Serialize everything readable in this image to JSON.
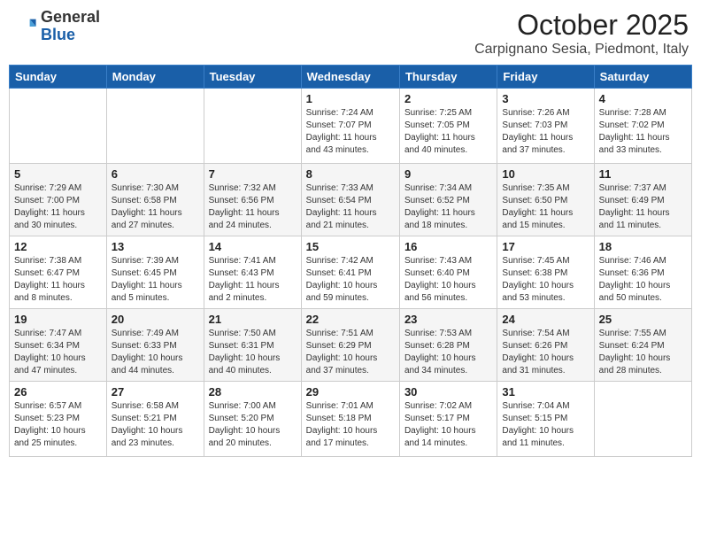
{
  "header": {
    "logo_general": "General",
    "logo_blue": "Blue",
    "month_title": "October 2025",
    "location": "Carpignano Sesia, Piedmont, Italy"
  },
  "weekdays": [
    "Sunday",
    "Monday",
    "Tuesday",
    "Wednesday",
    "Thursday",
    "Friday",
    "Saturday"
  ],
  "weeks": [
    [
      {
        "day": "",
        "info": ""
      },
      {
        "day": "",
        "info": ""
      },
      {
        "day": "",
        "info": ""
      },
      {
        "day": "1",
        "info": "Sunrise: 7:24 AM\nSunset: 7:07 PM\nDaylight: 11 hours\nand 43 minutes."
      },
      {
        "day": "2",
        "info": "Sunrise: 7:25 AM\nSunset: 7:05 PM\nDaylight: 11 hours\nand 40 minutes."
      },
      {
        "day": "3",
        "info": "Sunrise: 7:26 AM\nSunset: 7:03 PM\nDaylight: 11 hours\nand 37 minutes."
      },
      {
        "day": "4",
        "info": "Sunrise: 7:28 AM\nSunset: 7:02 PM\nDaylight: 11 hours\nand 33 minutes."
      }
    ],
    [
      {
        "day": "5",
        "info": "Sunrise: 7:29 AM\nSunset: 7:00 PM\nDaylight: 11 hours\nand 30 minutes."
      },
      {
        "day": "6",
        "info": "Sunrise: 7:30 AM\nSunset: 6:58 PM\nDaylight: 11 hours\nand 27 minutes."
      },
      {
        "day": "7",
        "info": "Sunrise: 7:32 AM\nSunset: 6:56 PM\nDaylight: 11 hours\nand 24 minutes."
      },
      {
        "day": "8",
        "info": "Sunrise: 7:33 AM\nSunset: 6:54 PM\nDaylight: 11 hours\nand 21 minutes."
      },
      {
        "day": "9",
        "info": "Sunrise: 7:34 AM\nSunset: 6:52 PM\nDaylight: 11 hours\nand 18 minutes."
      },
      {
        "day": "10",
        "info": "Sunrise: 7:35 AM\nSunset: 6:50 PM\nDaylight: 11 hours\nand 15 minutes."
      },
      {
        "day": "11",
        "info": "Sunrise: 7:37 AM\nSunset: 6:49 PM\nDaylight: 11 hours\nand 11 minutes."
      }
    ],
    [
      {
        "day": "12",
        "info": "Sunrise: 7:38 AM\nSunset: 6:47 PM\nDaylight: 11 hours\nand 8 minutes."
      },
      {
        "day": "13",
        "info": "Sunrise: 7:39 AM\nSunset: 6:45 PM\nDaylight: 11 hours\nand 5 minutes."
      },
      {
        "day": "14",
        "info": "Sunrise: 7:41 AM\nSunset: 6:43 PM\nDaylight: 11 hours\nand 2 minutes."
      },
      {
        "day": "15",
        "info": "Sunrise: 7:42 AM\nSunset: 6:41 PM\nDaylight: 10 hours\nand 59 minutes."
      },
      {
        "day": "16",
        "info": "Sunrise: 7:43 AM\nSunset: 6:40 PM\nDaylight: 10 hours\nand 56 minutes."
      },
      {
        "day": "17",
        "info": "Sunrise: 7:45 AM\nSunset: 6:38 PM\nDaylight: 10 hours\nand 53 minutes."
      },
      {
        "day": "18",
        "info": "Sunrise: 7:46 AM\nSunset: 6:36 PM\nDaylight: 10 hours\nand 50 minutes."
      }
    ],
    [
      {
        "day": "19",
        "info": "Sunrise: 7:47 AM\nSunset: 6:34 PM\nDaylight: 10 hours\nand 47 minutes."
      },
      {
        "day": "20",
        "info": "Sunrise: 7:49 AM\nSunset: 6:33 PM\nDaylight: 10 hours\nand 44 minutes."
      },
      {
        "day": "21",
        "info": "Sunrise: 7:50 AM\nSunset: 6:31 PM\nDaylight: 10 hours\nand 40 minutes."
      },
      {
        "day": "22",
        "info": "Sunrise: 7:51 AM\nSunset: 6:29 PM\nDaylight: 10 hours\nand 37 minutes."
      },
      {
        "day": "23",
        "info": "Sunrise: 7:53 AM\nSunset: 6:28 PM\nDaylight: 10 hours\nand 34 minutes."
      },
      {
        "day": "24",
        "info": "Sunrise: 7:54 AM\nSunset: 6:26 PM\nDaylight: 10 hours\nand 31 minutes."
      },
      {
        "day": "25",
        "info": "Sunrise: 7:55 AM\nSunset: 6:24 PM\nDaylight: 10 hours\nand 28 minutes."
      }
    ],
    [
      {
        "day": "26",
        "info": "Sunrise: 6:57 AM\nSunset: 5:23 PM\nDaylight: 10 hours\nand 25 minutes."
      },
      {
        "day": "27",
        "info": "Sunrise: 6:58 AM\nSunset: 5:21 PM\nDaylight: 10 hours\nand 23 minutes."
      },
      {
        "day": "28",
        "info": "Sunrise: 7:00 AM\nSunset: 5:20 PM\nDaylight: 10 hours\nand 20 minutes."
      },
      {
        "day": "29",
        "info": "Sunrise: 7:01 AM\nSunset: 5:18 PM\nDaylight: 10 hours\nand 17 minutes."
      },
      {
        "day": "30",
        "info": "Sunrise: 7:02 AM\nSunset: 5:17 PM\nDaylight: 10 hours\nand 14 minutes."
      },
      {
        "day": "31",
        "info": "Sunrise: 7:04 AM\nSunset: 5:15 PM\nDaylight: 10 hours\nand 11 minutes."
      },
      {
        "day": "",
        "info": ""
      }
    ]
  ]
}
